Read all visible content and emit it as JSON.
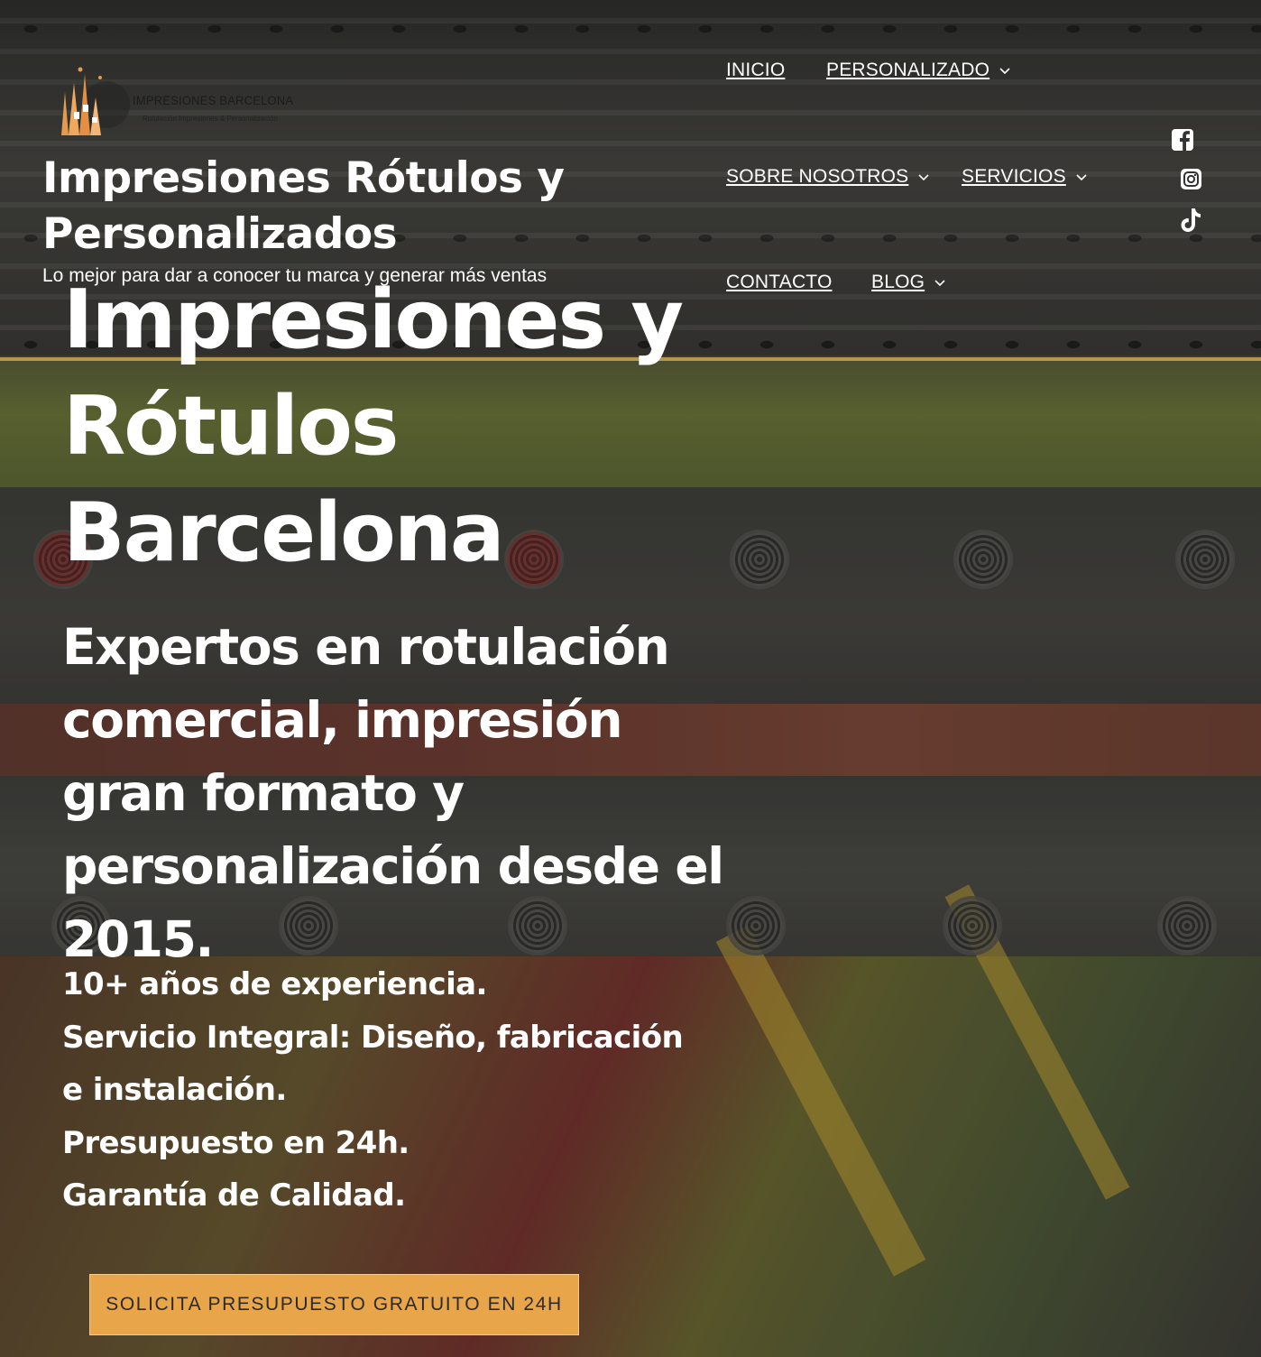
{
  "header": {
    "logo_caption": "IMPRESIONES BARCELONA",
    "logo_subcaption": "Rotulación Impresiones & Personalización",
    "site_title": "Impresiones Rótulos y Personalizados",
    "tagline": "Lo mejor para dar a conocer tu marca y generar más ventas"
  },
  "nav": {
    "items": [
      {
        "label": "INICIO",
        "has_dropdown": false
      },
      {
        "label": "PERSONALIZADO",
        "has_dropdown": true
      },
      {
        "label": "SOBRE NOSOTROS",
        "has_dropdown": true
      },
      {
        "label": "SERVICIOS",
        "has_dropdown": true
      },
      {
        "label": "CONTACTO",
        "has_dropdown": false
      },
      {
        "label": "BLOG",
        "has_dropdown": true
      }
    ]
  },
  "social": {
    "icons": [
      "facebook-icon",
      "instagram-icon",
      "tiktok-icon"
    ]
  },
  "hero": {
    "title_lines": [
      "Impresiones y",
      "Rótulos",
      "Barcelona"
    ],
    "subtitle": "Expertos en rotulación comercial, impresión gran formato y personalización desde el 2015.",
    "features": [
      "10+ años de experiencia.",
      "Servicio Integral: Diseño, fabricación e instalación.",
      "Presupuesto en 24h.",
      "Garantía de Calidad."
    ],
    "cta_label": "SOLICITA PRESUPUESTO GRATUITO EN 24H"
  },
  "colors": {
    "accent_gold": "#b7954a",
    "cta_background": "#e8a54a",
    "text": "#ffffff",
    "cta_text": "#2b2b2b"
  }
}
